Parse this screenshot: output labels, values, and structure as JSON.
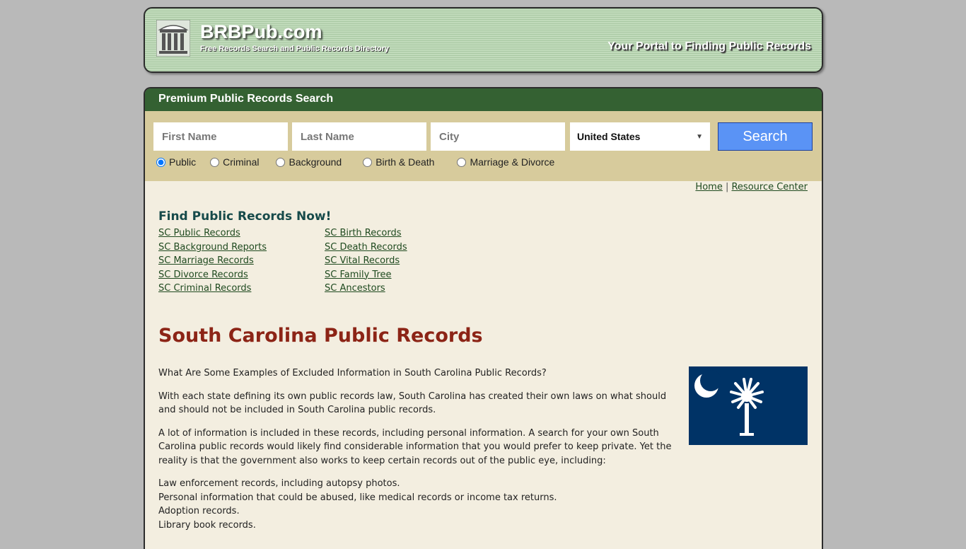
{
  "header": {
    "site_name": "BRBPub.com",
    "tagline": "Free Records Search and Public Records Directory",
    "slogan": "Your Portal to Finding Public Records"
  },
  "search": {
    "title": "Premium Public Records Search",
    "first_name_placeholder": "First Name",
    "last_name_placeholder": "Last Name",
    "city_placeholder": "City",
    "country_selected": "United States",
    "search_label": "Search",
    "radio_options": [
      {
        "label": "Public",
        "checked": true
      },
      {
        "label": "Criminal",
        "checked": false
      },
      {
        "label": "Background",
        "checked": false
      },
      {
        "label": "Birth & Death",
        "checked": false
      },
      {
        "label": "Marriage & Divorce",
        "checked": false
      }
    ]
  },
  "nav": {
    "home": "Home",
    "separator": "|",
    "resource_center": "Resource Center"
  },
  "find": {
    "title": "Find Public Records Now!",
    "col1": [
      "SC Public Records",
      "SC Background Reports",
      "SC Marriage Records",
      "SC Divorce Records",
      "SC Criminal Records"
    ],
    "col2": [
      "SC Birth Records",
      "SC Death Records",
      "SC Vital Records",
      "SC Family Tree",
      "SC Ancestors"
    ]
  },
  "main": {
    "title": "South Carolina Public Records",
    "paragraphs": [
      "What Are Some Examples of Excluded Information in South Carolina Public Records?",
      "With each state defining its own public records law, South Carolina has created their own laws on what should and should not be included in South Carolina public records.",
      "A lot of information is included in these records, including personal information. A search for your own South Carolina public records would likely find considerable information that you would prefer to keep private. Yet the reality is that the government also works to keep certain records out of the public eye, including:"
    ],
    "list": [
      "Law enforcement records, including autopsy photos.",
      "Personal information that could be abused, like medical records or income tax returns.",
      "Adoption records.",
      "Library book records."
    ],
    "flag_alt": "South Carolina flag"
  },
  "colors": {
    "header_green": "#346132",
    "search_bg": "#d7cb9c",
    "content_bg": "#f3eee0",
    "title_red": "#8c2416",
    "link_green": "#1f4a1f",
    "search_button": "#5a93f5",
    "flag_blue": "#003366"
  }
}
